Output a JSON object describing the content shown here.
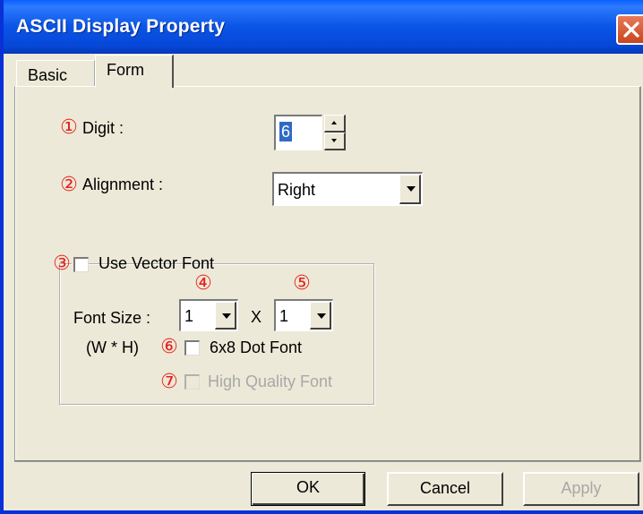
{
  "window": {
    "title": "ASCII Display Property"
  },
  "tabs": {
    "basic": "Basic",
    "form": "Form"
  },
  "markers": [
    "①",
    "②",
    "③",
    "④",
    "⑤",
    "⑥",
    "⑦"
  ],
  "form": {
    "digit_label": "Digit :",
    "digit_value": "6",
    "alignment_label": "Alignment :",
    "alignment_value": "Right",
    "use_vector_font_label": "Use Vector Font",
    "use_vector_font_checked": false,
    "font_size_label": "Font Size :",
    "font_width_value": "1",
    "x_label": "X",
    "font_height_value": "1",
    "wh_label": "(W * H)",
    "dot_font_label": "6x8 Dot Font",
    "dot_font_checked": false,
    "hq_font_label": "High Quality Font",
    "hq_font_checked": false,
    "hq_font_enabled": false
  },
  "buttons": {
    "ok": "OK",
    "cancel": "Cancel",
    "apply": "Apply"
  },
  "colors": {
    "marker": "#e8201a",
    "titlebar": "#0a54e6",
    "selection": "#316ac5"
  }
}
